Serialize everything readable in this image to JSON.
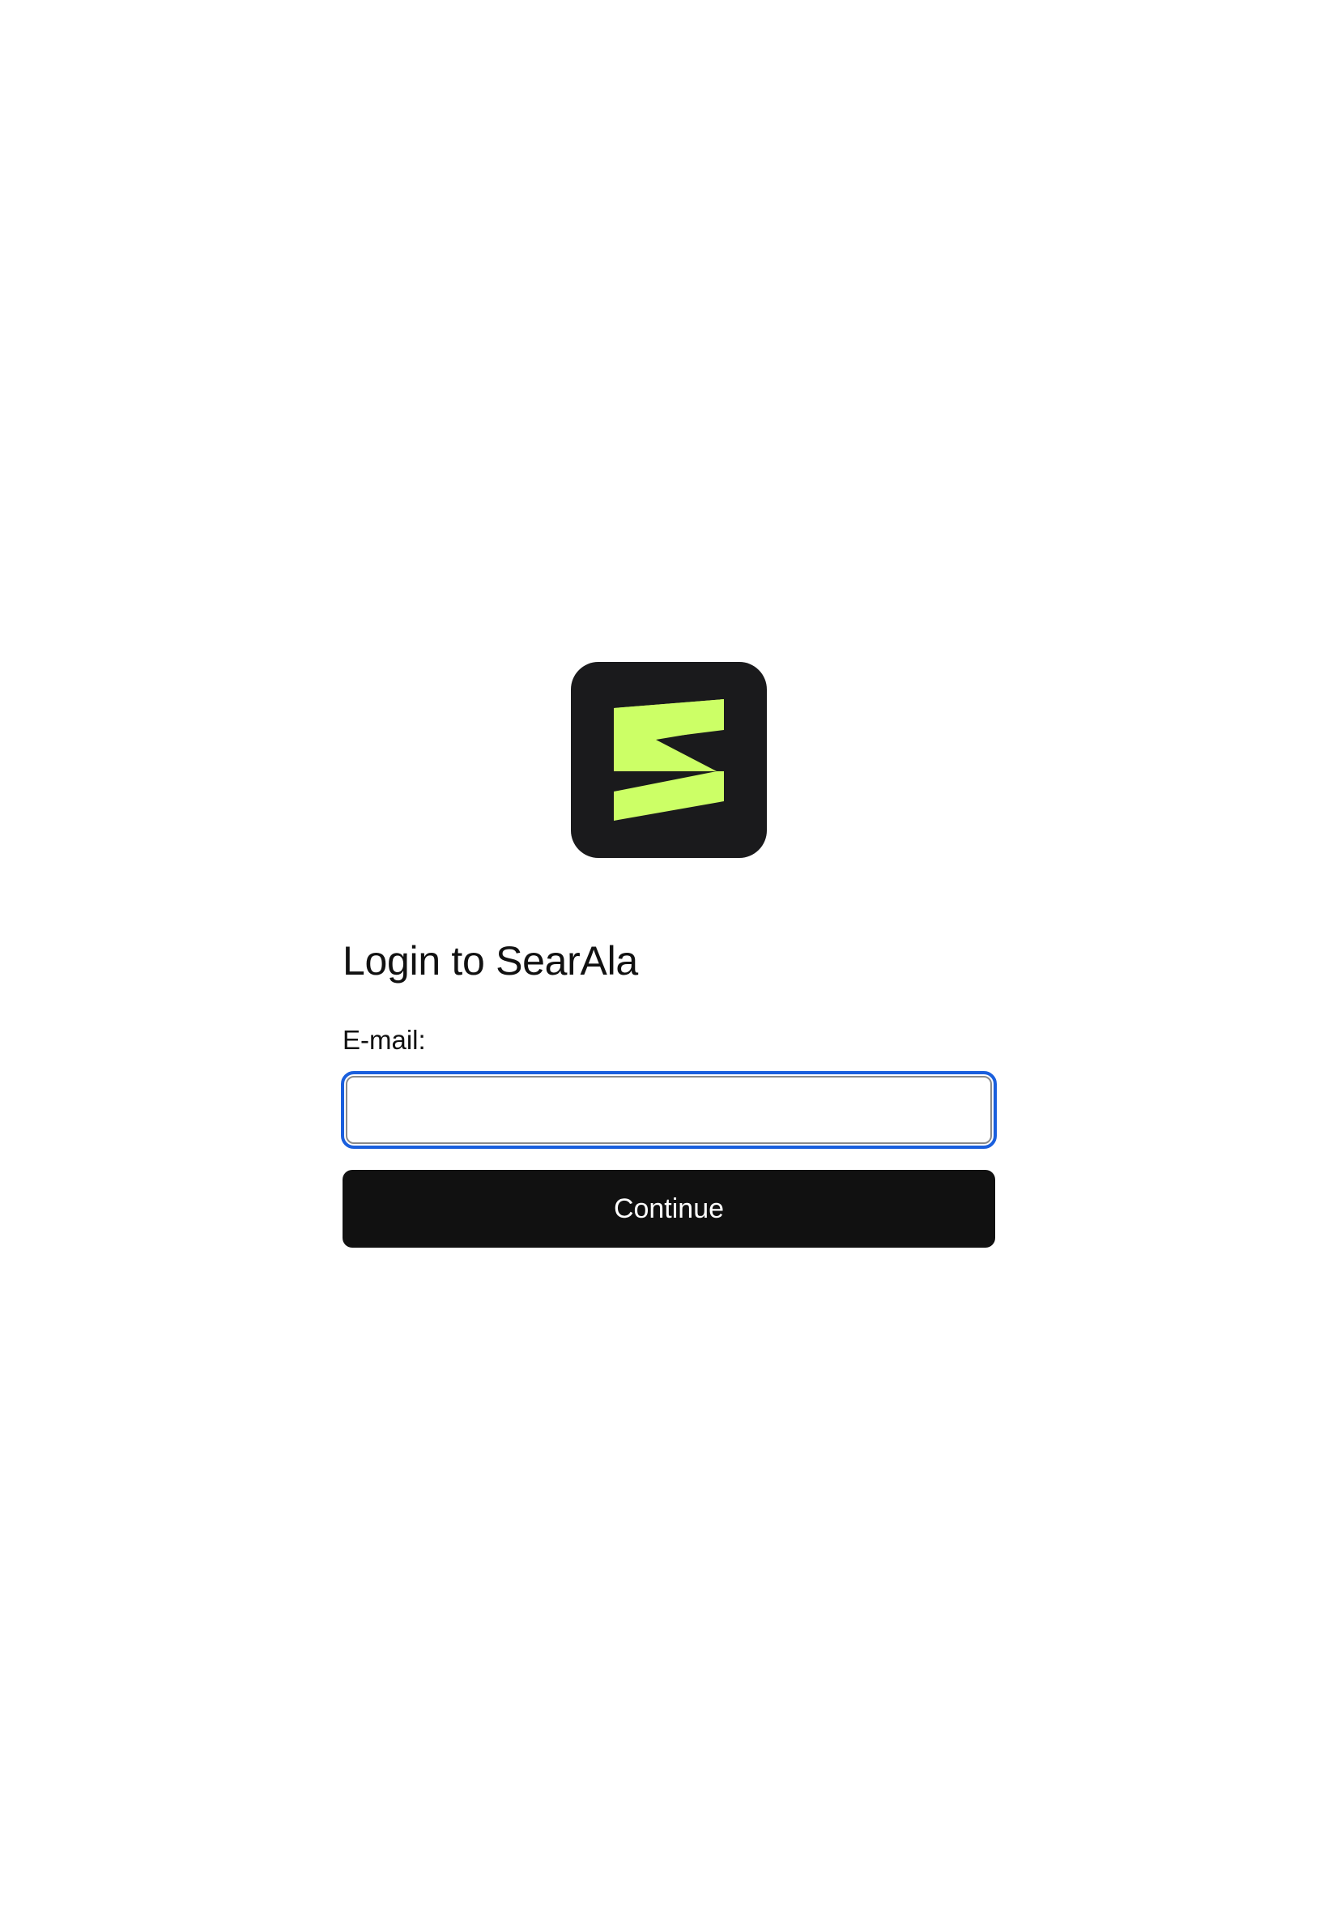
{
  "app": {
    "logo": "searala-logo-icon",
    "brand_color": "#ccff66",
    "logo_bg_color": "#1a1a1c"
  },
  "login": {
    "title": "Login to SearAla",
    "email_label": "E-mail:",
    "email_value": "",
    "continue_label": "Continue"
  },
  "colors": {
    "focus_ring": "#1a5fdd",
    "button_bg": "#111111",
    "button_text": "#ffffff"
  }
}
